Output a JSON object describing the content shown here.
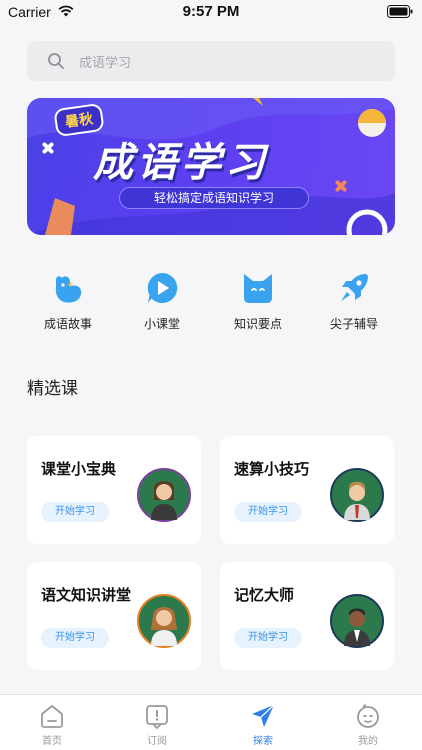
{
  "status_bar": {
    "carrier": "Carrier",
    "time": "9:57 PM"
  },
  "search": {
    "placeholder": "成语学习"
  },
  "banner": {
    "tag": "暑秋",
    "title": "成语学习",
    "subtitle": "轻松搞定成语知识学习"
  },
  "quick_entries": [
    {
      "label": "成语故事",
      "icon": "bird-icon"
    },
    {
      "label": "小课堂",
      "icon": "play-icon"
    },
    {
      "label": "知识要点",
      "icon": "cat-icon"
    },
    {
      "label": "尖子辅导",
      "icon": "rocket-icon"
    }
  ],
  "section": {
    "title": "精选课"
  },
  "courses": [
    {
      "title": "课堂小宝典",
      "button": "开始学习"
    },
    {
      "title": "速算小技巧",
      "button": "开始学习"
    },
    {
      "title": "语文知识讲堂",
      "button": "开始学习"
    },
    {
      "title": "记忆大师",
      "button": "开始学习"
    }
  ],
  "tabs": [
    {
      "label": "首页",
      "icon": "home-icon",
      "active": false
    },
    {
      "label": "订阅",
      "icon": "subscribe-icon",
      "active": false
    },
    {
      "label": "探索",
      "icon": "explore-icon",
      "active": true
    },
    {
      "label": "我的",
      "icon": "profile-icon",
      "active": false
    }
  ],
  "colors": {
    "accent": "#2f7ef0",
    "banner": "#5c3ff0",
    "button_bg": "#e6f2fd",
    "button_text": "#3a93ea"
  }
}
